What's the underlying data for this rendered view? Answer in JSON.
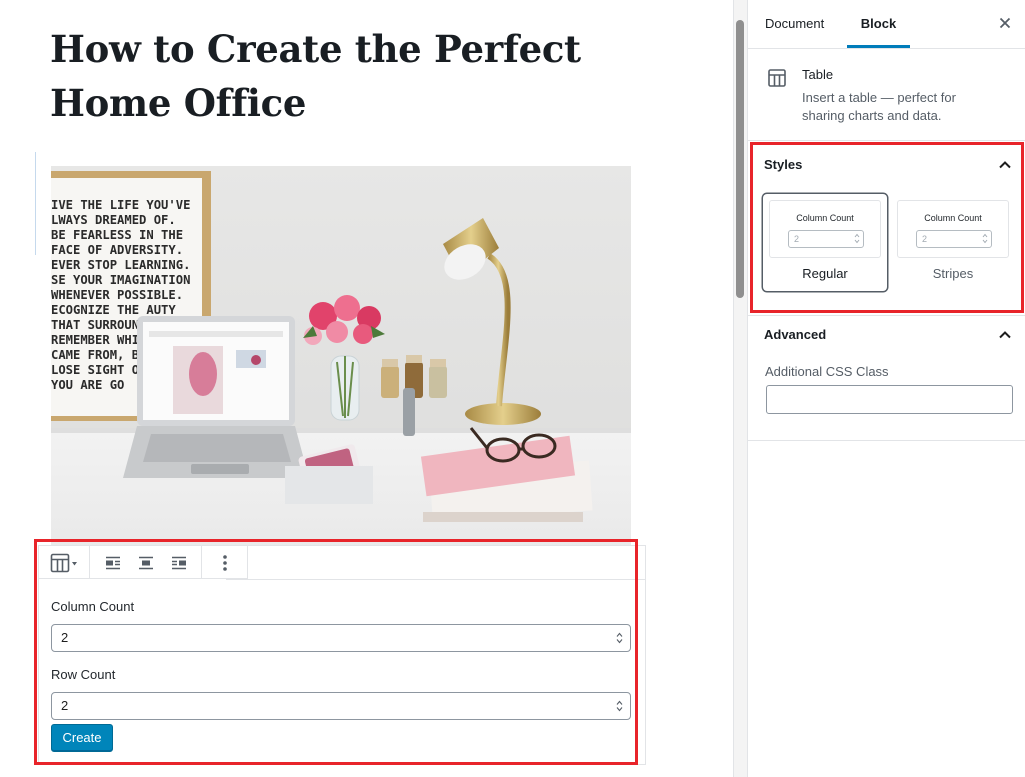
{
  "post": {
    "title": "How to Create the Perfect Home Office",
    "poster_lines": [
      "IVE THE LIFE YOU'VE",
      "LWAYS DREAMED OF.",
      "BE FEARLESS IN THE",
      "FACE OF ADVERSITY.",
      "EVER STOP LEARNING.",
      "SE YOUR IMAGINATION",
      "WHENEVER POSSIBLE.",
      "ECOGNIZE THE    AUTY",
      "THAT SURROUN",
      "REMEMBER WHI",
      "CAME FROM, BU",
      "LOSE SIGHT OF",
      "YOU ARE GO"
    ]
  },
  "table_placeholder": {
    "column_count_label": "Column Count",
    "column_count_value": "2",
    "row_count_label": "Row Count",
    "row_count_value": "2",
    "create_label": "Create"
  },
  "toolbar": {
    "icons": [
      "table-icon",
      "align-left-icon",
      "align-center-icon",
      "align-right-icon",
      "more-options-icon"
    ]
  },
  "sidebar": {
    "tabs": [
      {
        "label": "Document",
        "active": false
      },
      {
        "label": "Block",
        "active": true
      }
    ],
    "block_card": {
      "title": "Table",
      "description": "Insert a table — perfect for sharing charts and data."
    },
    "styles": {
      "heading": "Styles",
      "options": [
        {
          "name": "Regular",
          "preview_label": "Column Count",
          "preview_value": "2",
          "selected": true
        },
        {
          "name": "Stripes",
          "preview_label": "Column Count",
          "preview_value": "2",
          "selected": false
        }
      ]
    },
    "advanced": {
      "heading": "Advanced",
      "css_class_label": "Additional CSS Class",
      "css_class_value": ""
    }
  },
  "colors": {
    "accent": "#007cba",
    "primary_button": "#0085ba",
    "highlight": "#e8242a"
  }
}
